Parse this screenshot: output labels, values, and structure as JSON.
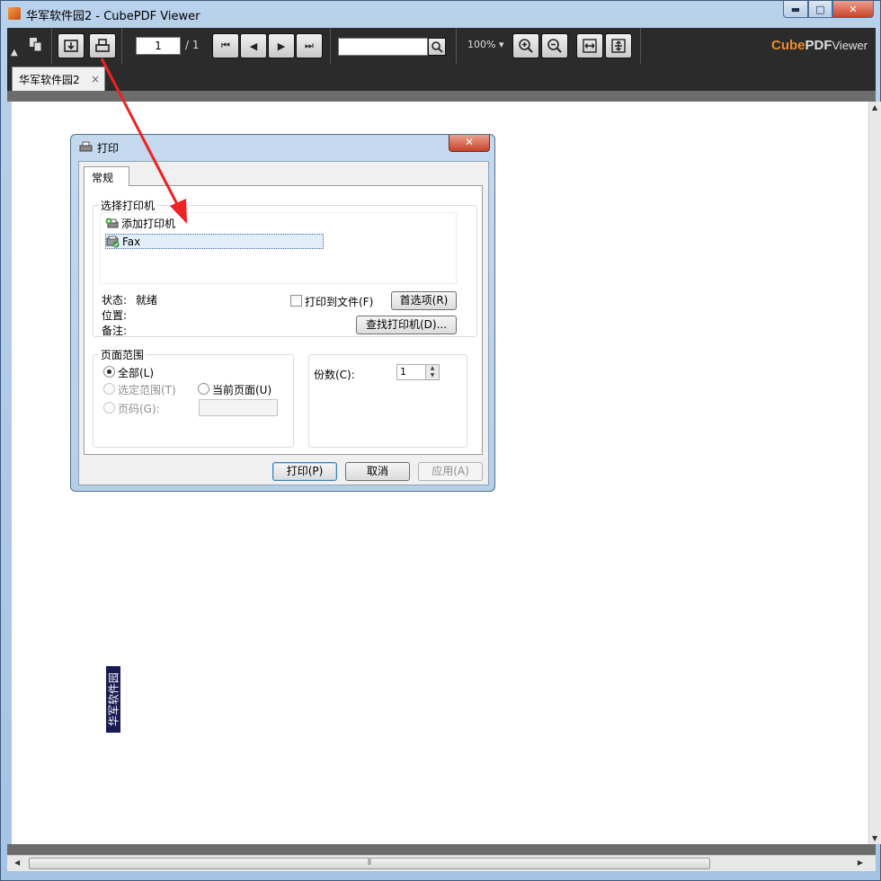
{
  "window": {
    "title": "华军软件园2 - CubePDF Viewer",
    "minimize": "▬",
    "maximize": "□",
    "close": "✕"
  },
  "toolbar": {
    "page_current": "1",
    "page_total": "/ 1",
    "zoom": "100% ▾",
    "brand_cube": "Cube",
    "brand_pdf": "PDF",
    "brand_viewer": "Viewer"
  },
  "tabs": [
    {
      "label": "华军软件园2",
      "close": "×"
    }
  ],
  "document": {
    "stamp_text": "华军软件园"
  },
  "dialog": {
    "title": "打印",
    "close": "✕",
    "tab_general": "常规",
    "select_printer_legend": "选择打印机",
    "printers": [
      {
        "label": "添加打印机",
        "icon": "add-printer-icon"
      },
      {
        "label": "Fax",
        "icon": "fax-printer-icon"
      }
    ],
    "status_label": "状态:",
    "status_value": "就绪",
    "location_label": "位置:",
    "comment_label": "备注:",
    "print_to_file": "打印到文件(F)",
    "preferences_button": "首选项(R)",
    "find_printer_button": "查找打印机(D)...",
    "page_range_legend": "页面范围",
    "range_all": "全部(L)",
    "range_selection": "选定范围(T)",
    "range_current": "当前页面(U)",
    "range_pages": "页码(G):",
    "copies_label": "份数(C):",
    "copies_value": "1",
    "print_button": "打印(P)",
    "cancel_button": "取消",
    "apply_button": "应用(A)"
  },
  "colors": {
    "toolbar_bg": "#2b2b2b",
    "brand_accent": "#f08a24",
    "annotation_arrow": "#ee2222"
  }
}
